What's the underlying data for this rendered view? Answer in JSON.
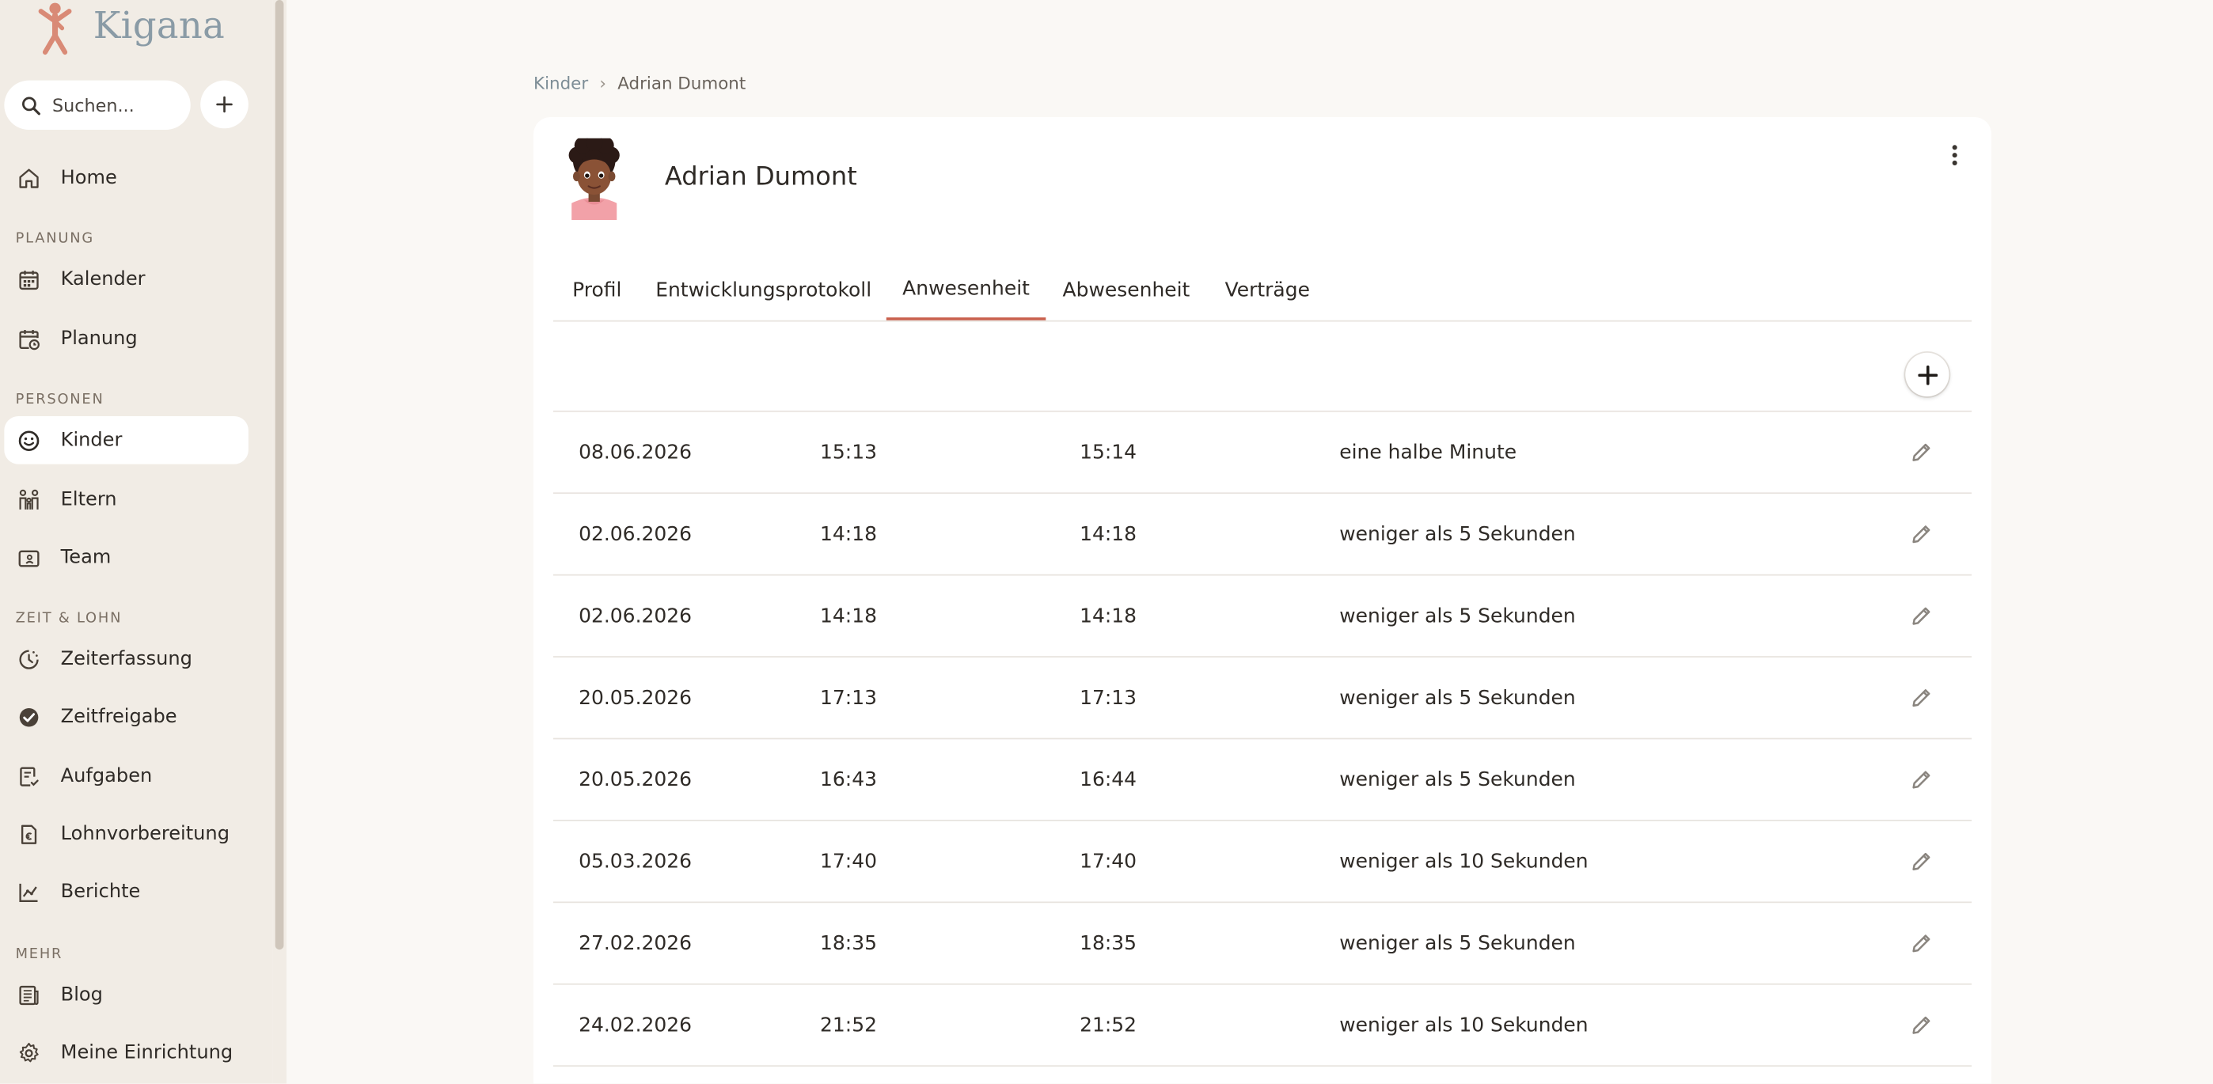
{
  "app": {
    "name": "Kigana",
    "search_placeholder": "Suchen..."
  },
  "sidebar": {
    "home": "Home",
    "sections": {
      "planung": "PLANUNG",
      "personen": "PERSONEN",
      "zeit": "ZEIT & LOHN",
      "mehr": "MEHR"
    },
    "items": {
      "kalender": "Kalender",
      "planung": "Planung",
      "kinder": "Kinder",
      "eltern": "Eltern",
      "team": "Team",
      "zeiterfassung": "Zeiterfassung",
      "zeitfreigabe": "Zeitfreigabe",
      "aufgaben": "Aufgaben",
      "lohnvorbereitung": "Lohnvorbereitung",
      "berichte": "Berichte",
      "blog": "Blog",
      "einrichtung": "Meine Einrichtung"
    },
    "active_item": "Kinder"
  },
  "breadcrumb": {
    "parent": "Kinder",
    "separator": "›",
    "current": "Adrian Dumont"
  },
  "child": {
    "name": "Adrian Dumont"
  },
  "tabs": [
    "Profil",
    "Entwicklungsprotokoll",
    "Anwesenheit",
    "Abwesenheit",
    "Verträge"
  ],
  "active_tab": "Anwesenheit",
  "attendance": [
    {
      "date": "08.06.2026",
      "start": "15:13",
      "end": "15:14",
      "duration": "eine halbe Minute"
    },
    {
      "date": "02.06.2026",
      "start": "14:18",
      "end": "14:18",
      "duration": "weniger als 5 Sekunden"
    },
    {
      "date": "02.06.2026",
      "start": "14:18",
      "end": "14:18",
      "duration": "weniger als 5 Sekunden"
    },
    {
      "date": "20.05.2026",
      "start": "17:13",
      "end": "17:13",
      "duration": "weniger als 5 Sekunden"
    },
    {
      "date": "20.05.2026",
      "start": "16:43",
      "end": "16:44",
      "duration": "weniger als 5 Sekunden"
    },
    {
      "date": "05.03.2026",
      "start": "17:40",
      "end": "17:40",
      "duration": "weniger als 10 Sekunden"
    },
    {
      "date": "27.02.2026",
      "start": "18:35",
      "end": "18:35",
      "duration": "weniger als 5 Sekunden"
    },
    {
      "date": "24.02.2026",
      "start": "21:52",
      "end": "21:52",
      "duration": "weniger als 10 Sekunden"
    }
  ],
  "colors": {
    "accent": "#c9614e",
    "sidebar_bg": "#f1ece5",
    "page_bg": "#faf8f5",
    "logo_mark": "#d98a76",
    "logo_text": "#8a9ba6"
  }
}
